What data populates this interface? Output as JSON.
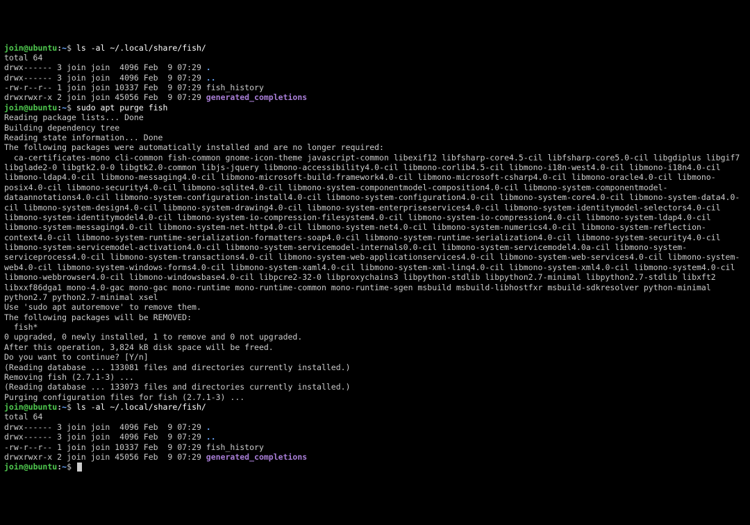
{
  "prompt": {
    "user": "join",
    "host": "ubuntu",
    "path": "~"
  },
  "cmd1": "ls -al ~/.local/share/fish/",
  "ls1": {
    "total": "total 64",
    "r0": "drwx------ 3 join join  4096 Feb  9 07:29 ",
    "r0n": ".",
    "r1": "drwx------ 3 join join  4096 Feb  9 07:29 ",
    "r1n": "..",
    "r2": "-rw-r--r-- 1 join join 10337 Feb  9 07:29 fish_history",
    "r3": "drwxrwxr-x 2 join join 45056 Feb  9 07:29 ",
    "r3n": "generated_completions"
  },
  "cmd2": "sudo apt purge fish",
  "apt": {
    "l0": "Reading package lists... Done",
    "l1": "Building dependency tree",
    "l2": "Reading state information... Done",
    "l3": "The following packages were automatically installed and are no longer required:",
    "pkgs": "  ca-certificates-mono cli-common fish-common gnome-icon-theme javascript-common libexif12 libfsharp-core4.5-cil libfsharp-core5.0-cil libgdiplus libgif7 libglade2-0 libgtk2.0-0 libgtk2.0-common libjs-jquery libmono-accessibility4.0-cil libmono-corlib4.5-cil libmono-i18n-west4.0-cil libmono-i18n4.0-cil libmono-ldap4.0-cil libmono-messaging4.0-cil libmono-microsoft-build-framework4.0-cil libmono-microsoft-csharp4.0-cil libmono-oracle4.0-cil libmono-posix4.0-cil libmono-security4.0-cil libmono-sqlite4.0-cil libmono-system-componentmodel-composition4.0-cil libmono-system-componentmodel-dataannotations4.0-cil libmono-system-configuration-install4.0-cil libmono-system-configuration4.0-cil libmono-system-core4.0-cil libmono-system-data4.0-cil libmono-system-design4.0-cil libmono-system-drawing4.0-cil libmono-system-enterpriseservices4.0-cil libmono-system-identitymodel-selectors4.0-cil libmono-system-identitymodel4.0-cil libmono-system-io-compression-filesystem4.0-cil libmono-system-io-compression4.0-cil libmono-system-ldap4.0-cil libmono-system-messaging4.0-cil libmono-system-net-http4.0-cil libmono-system-net4.0-cil libmono-system-numerics4.0-cil libmono-system-reflection-context4.0-cil libmono-system-runtime-serialization-formatters-soap4.0-cil libmono-system-runtime-serialization4.0-cil libmono-system-security4.0-cil libmono-system-servicemodel-activation4.0-cil libmono-system-servicemodel-internals0.0-cil libmono-system-servicemodel4.0a-cil libmono-system-serviceprocess4.0-cil libmono-system-transactions4.0-cil libmono-system-web-applicationservices4.0-cil libmono-system-web-services4.0-cil libmono-system-web4.0-cil libmono-system-windows-forms4.0-cil libmono-system-xaml4.0-cil libmono-system-xml-linq4.0-cil libmono-system-xml4.0-cil libmono-system4.0-cil libmono-webbrowser4.0-cil libmono-windowsbase4.0-cil libpcre2-32-0 libproxychains3 libpython-stdlib libpython2.7-minimal libpython2.7-stdlib libxft2 libxxf86dga1 mono-4.0-gac mono-gac mono-runtime mono-runtime-common mono-runtime-sgen msbuild msbuild-libhostfxr msbuild-sdkresolver python-minimal python2.7 python2.7-minimal xsel",
    "l4": "Use 'sudo apt autoremove' to remove them.",
    "l5": "The following packages will be REMOVED:",
    "l6": "  fish*",
    "l7": "0 upgraded, 0 newly installed, 1 to remove and 0 not upgraded.",
    "l8": "After this operation, 3,824 kB disk space will be freed.",
    "l9": "Do you want to continue? [Y/n]",
    "l10": "(Reading database ... 133081 files and directories currently installed.)",
    "l11": "Removing fish (2.7.1-3) ...",
    "l12": "(Reading database ... 133073 files and directories currently installed.)",
    "l13": "Purging configuration files for fish (2.7.1-3) ..."
  },
  "cmd3": "ls -al ~/.local/share/fish/",
  "ls2": {
    "total": "total 64",
    "r0": "drwx------ 3 join join  4096 Feb  9 07:29 ",
    "r0n": ".",
    "r1": "drwx------ 3 join join  4096 Feb  9 07:29 ",
    "r1n": "..",
    "r2": "-rw-r--r-- 1 join join 10337 Feb  9 07:29 fish_history",
    "r3": "drwxrwxr-x 2 join join 45056 Feb  9 07:29 ",
    "r3n": "generated_completions"
  }
}
